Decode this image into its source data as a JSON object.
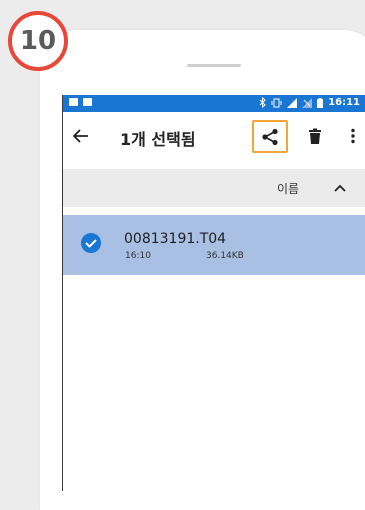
{
  "step": {
    "number": "10",
    "color": "#e8473a"
  },
  "status_bar": {
    "time": "16:11",
    "background": "#1976d2"
  },
  "toolbar": {
    "title": "1개 선택됨",
    "back_icon": "arrow-left-icon",
    "share_icon": "share-icon",
    "delete_icon": "trash-icon",
    "more_icon": "more-vert-icon",
    "highlight_color": "#f3a536"
  },
  "sort": {
    "label": "이름",
    "direction_icon": "chevron-up-icon"
  },
  "files": [
    {
      "name": "00813191.T04",
      "time": "16:10",
      "size": "36.14KB",
      "selected": true
    }
  ],
  "colors": {
    "selected_row": "#a9bfe3",
    "check": "#1976d2"
  }
}
